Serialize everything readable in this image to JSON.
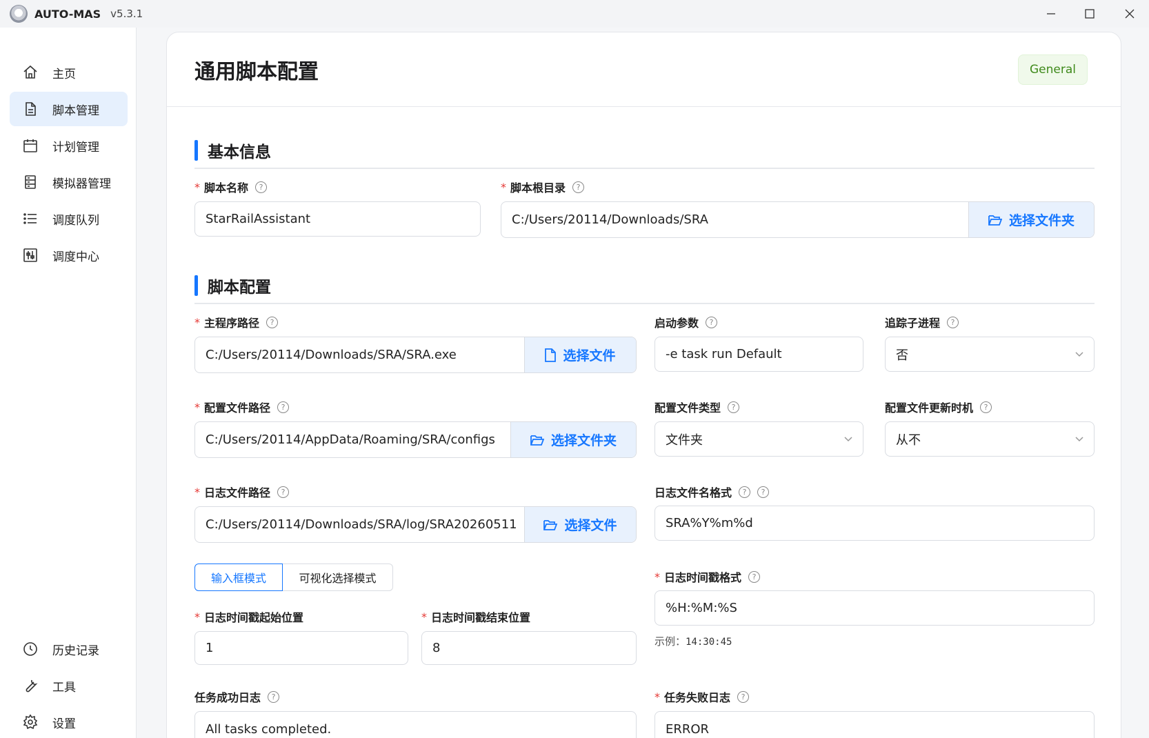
{
  "app": {
    "name": "AUTO-MAS",
    "version": "v5.3.1"
  },
  "sidebar": {
    "top_items": [
      {
        "label": "主页",
        "icon": "home-icon"
      },
      {
        "label": "脚本管理",
        "icon": "file-icon",
        "active": true
      },
      {
        "label": "计划管理",
        "icon": "calendar-icon"
      },
      {
        "label": "模拟器管理",
        "icon": "server-icon"
      },
      {
        "label": "调度队列",
        "icon": "list-icon"
      },
      {
        "label": "调度中心",
        "icon": "control-icon"
      }
    ],
    "bottom_items": [
      {
        "label": "历史记录",
        "icon": "history-icon"
      },
      {
        "label": "工具",
        "icon": "wrench-icon"
      },
      {
        "label": "设置",
        "icon": "gear-icon"
      }
    ]
  },
  "header": {
    "title": "通用脚本配置",
    "badge": "General"
  },
  "sections": {
    "basic": "基本信息",
    "script": "脚本配置"
  },
  "fields": {
    "script_name": {
      "label": "脚本名称",
      "value": "StarRailAssistant"
    },
    "script_root": {
      "label": "脚本根目录",
      "value": "C:/Users/20114/Downloads/SRA",
      "button": "选择文件夹"
    },
    "main_path": {
      "label": "主程序路径",
      "value": "C:/Users/20114/Downloads/SRA/SRA.exe",
      "button": "选择文件"
    },
    "launch_args": {
      "label": "启动参数",
      "value": "-e task run Default"
    },
    "track_child": {
      "label": "追踪子进程",
      "value": "否"
    },
    "config_path": {
      "label": "配置文件路径",
      "value": "C:/Users/20114/AppData/Roaming/SRA/configs",
      "button": "选择文件夹"
    },
    "config_type": {
      "label": "配置文件类型",
      "value": "文件夹"
    },
    "config_update": {
      "label": "配置文件更新时机",
      "value": "从不"
    },
    "log_path": {
      "label": "日志文件路径",
      "value": "C:/Users/20114/Downloads/SRA/log/SRA20260511",
      "button": "选择文件"
    },
    "log_name_format": {
      "label": "日志文件名格式",
      "value": "SRA%Y%m%d"
    },
    "mode": {
      "input": "输入框模式",
      "visual": "可视化选择模式"
    },
    "ts_start": {
      "label": "日志时间戳起始位置",
      "value": "1"
    },
    "ts_end": {
      "label": "日志时间戳结束位置",
      "value": "8"
    },
    "ts_format": {
      "label": "日志时间戳格式",
      "value": "%H:%M:%S",
      "example_label": "示例：",
      "example_value": "14:30:45"
    },
    "success_log": {
      "label": "任务成功日志",
      "value": "All tasks completed."
    },
    "fail_log": {
      "label": "任务失败日志",
      "value": "ERROR"
    }
  }
}
